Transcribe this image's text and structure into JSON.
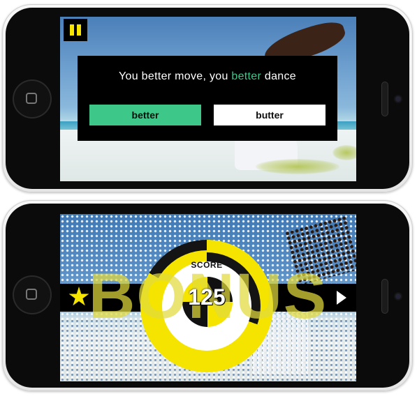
{
  "quiz_screen": {
    "lyric_before": "You better move, you ",
    "lyric_highlight": "better",
    "lyric_after": " dance",
    "answers": [
      "better",
      "butter"
    ],
    "pause_icon": "pause-icon"
  },
  "bonus_screen": {
    "bonus_text": "BONUS",
    "score_label": "SCORE",
    "score_value": "125",
    "star_icon": "star-icon",
    "next_icon": "play-arrow-icon"
  },
  "colors": {
    "accent_green": "#3dc88a",
    "accent_yellow": "#f5e400",
    "panel_black": "#000000"
  }
}
